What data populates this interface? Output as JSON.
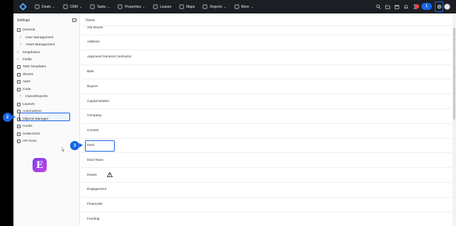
{
  "topnav": {
    "items": [
      {
        "label": "Deals",
        "icon": "deals-icon",
        "chevron": true
      },
      {
        "label": "CRM",
        "icon": "crm-icon",
        "chevron": true
      },
      {
        "label": "Tasks",
        "icon": "tasks-icon",
        "chevron": true
      },
      {
        "label": "Properties",
        "icon": "properties-icon",
        "chevron": true
      },
      {
        "label": "Leases",
        "icon": "leases-icon",
        "chevron": false
      },
      {
        "label": "Maps",
        "icon": "maps-icon",
        "chevron": false
      },
      {
        "label": "Reports",
        "icon": "reports-icon",
        "chevron": true
      },
      {
        "label": "More",
        "icon": "more-icon",
        "chevron": true
      }
    ],
    "step1": "1"
  },
  "sidebar": {
    "header": "Settings",
    "items": [
      {
        "label": "General",
        "icon": "gear-icon"
      },
      {
        "label": "User Management",
        "icon": "chevron-right-icon"
      },
      {
        "label": "Asset Management",
        "icon": "chevron-right-icon"
      },
      {
        "label": "Dropdowns",
        "icon": "chevron-right-icon"
      },
      {
        "label": "Fields",
        "icon": "chevron-right-icon"
      },
      {
        "label": "Task Templates",
        "icon": "task-template-icon"
      },
      {
        "label": "Sheets",
        "icon": "sheets-icon"
      },
      {
        "label": "Apps",
        "icon": "apps-icon"
      },
      {
        "label": "Code",
        "icon": "code-icon"
      },
      {
        "label": "Import/Exports",
        "icon": "chevron-right-icon"
      },
      {
        "label": "Layouts",
        "icon": "layouts-icon"
      },
      {
        "label": "Automations",
        "icon": "automations-icon"
      },
      {
        "label": "Objects Manager",
        "icon": "objects-icon"
      },
      {
        "label": "Hooks",
        "icon": "hooks-icon"
      },
      {
        "label": "SAML/SSO",
        "icon": "saml-icon"
      },
      {
        "label": "API Keys",
        "icon": "key-icon"
      }
    ],
    "step2": "2",
    "logo_letter": "E"
  },
  "main": {
    "column_header": "Name",
    "rows": [
      "AM Issues",
      "Address",
      "Approved General Contractor",
      "Bids",
      "Buyers",
      "Capital Market",
      "Company",
      "Contact",
      "Deal",
      "Deal Team",
      "Draws",
      "Engagement",
      "Financials",
      "Funding"
    ],
    "step3": "3"
  },
  "colors": {
    "accent": "#1765e8",
    "topbar": "#1b1e23"
  }
}
